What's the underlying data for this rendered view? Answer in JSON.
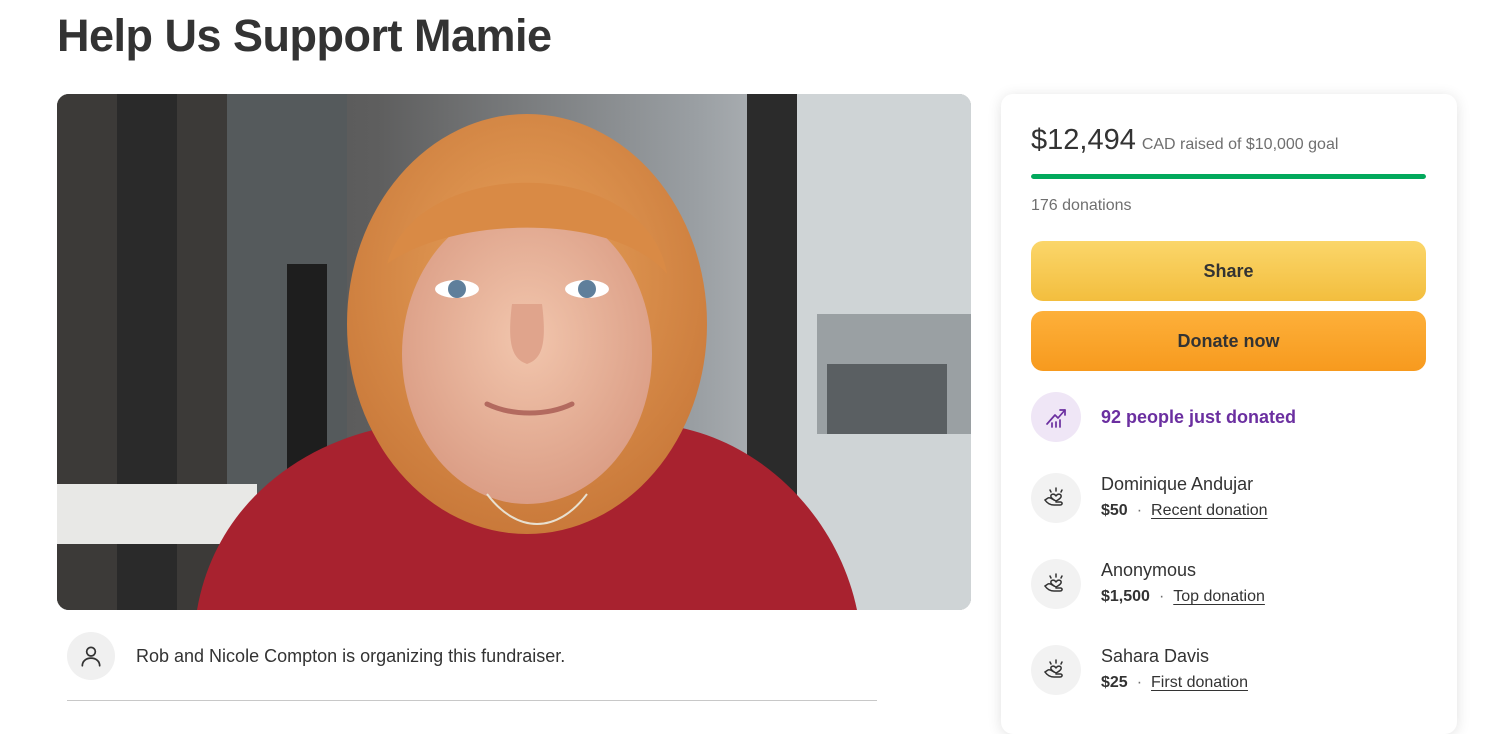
{
  "page": {
    "title": "Help Us Support Mamie"
  },
  "organizer": {
    "text": "Rob and Nicole Compton is organizing this fundraiser.",
    "icon": "user-outline-icon"
  },
  "campaign": {
    "raised_amount": "$12,494",
    "raised_suffix": "CAD raised of $10,000 goal",
    "progress_percent": 100,
    "progress_color": "#02a95c",
    "donation_count": "176 donations",
    "share_label": "Share",
    "donate_label": "Donate now",
    "trend_text": "92 people just donated",
    "trend_icon": "trending-up-icon"
  },
  "donations": [
    {
      "name": "Dominique Andujar",
      "amount": "$50",
      "separator": "·",
      "tag": "Recent donation",
      "icon": "heart-hands-icon"
    },
    {
      "name": "Anonymous",
      "amount": "$1,500",
      "separator": "·",
      "tag": "Top donation",
      "icon": "heart-hands-icon"
    },
    {
      "name": "Sahara Davis",
      "amount": "$25",
      "separator": "·",
      "tag": "First donation",
      "icon": "heart-hands-icon"
    }
  ],
  "colors": {
    "share_button": "#f3be3e",
    "donate_button": "#f79a1e",
    "trend_text": "#6b2fa0"
  }
}
